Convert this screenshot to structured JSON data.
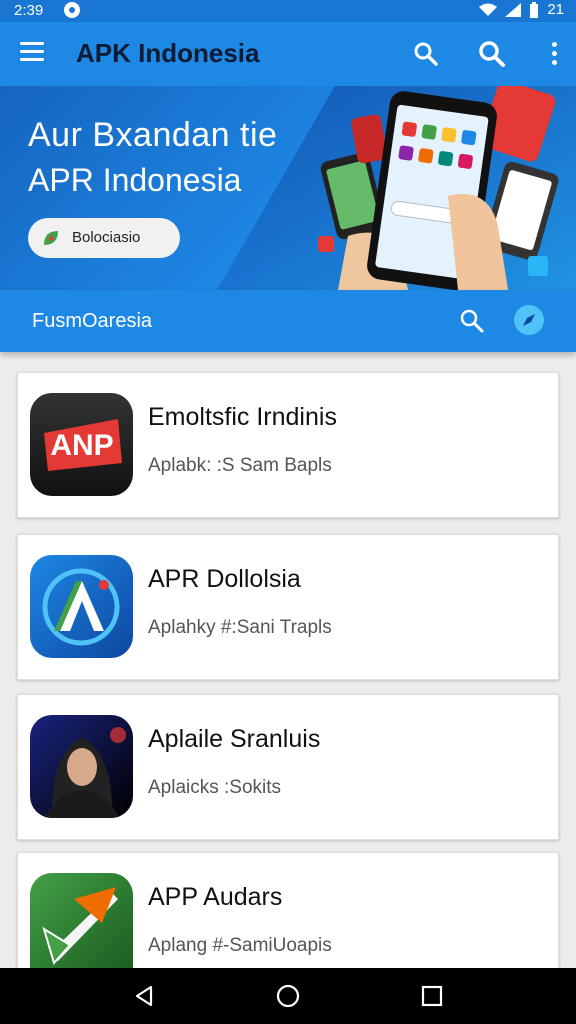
{
  "status_bar": {
    "time": "2:39",
    "battery": "21"
  },
  "app_bar": {
    "title": "APK Indonesia"
  },
  "hero": {
    "line1": "Aur Bxandan tie",
    "line2": "APR Indonesia",
    "pill_label": "Bolociasio"
  },
  "sub_bar": {
    "label": "FusmOaresia"
  },
  "apps": [
    {
      "name": "Emoltsfic Irndinis",
      "subtitle": "Aplabk: :S Sam Bapls",
      "icon_text": "ANP"
    },
    {
      "name": "APR Dollolsia",
      "subtitle": "Aplahky #:Sani Trapls"
    },
    {
      "name": "Aplaile Sranluis",
      "subtitle": "Aplaicks :Sokits"
    },
    {
      "name": "APP Audars",
      "subtitle": "Aplang #-SamiUoapis"
    }
  ],
  "colors": {
    "primary": "#1e88e5",
    "status": "#1976d2",
    "background": "#ececec"
  },
  "icons": [
    "menu-icon",
    "search-icon",
    "more-vert-icon",
    "back-icon",
    "home-icon",
    "recents-icon"
  ]
}
